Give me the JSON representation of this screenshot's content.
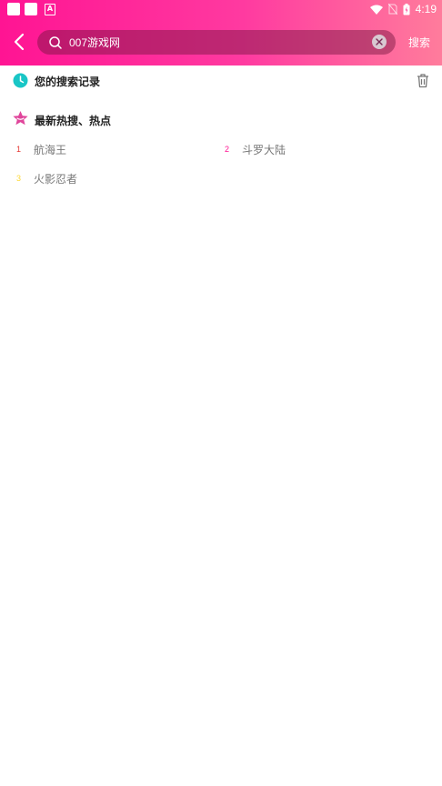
{
  "statusbar": {
    "time": "4:19"
  },
  "header": {
    "search_value": "007游戏网",
    "search_button": "搜索"
  },
  "history": {
    "title": "您的搜索记录"
  },
  "hot": {
    "title": "最新热搜、热点",
    "items": [
      {
        "rank": "1",
        "label": "航海王",
        "color": "#e53935"
      },
      {
        "rank": "2",
        "label": "斗罗大陆",
        "color": "#ff1493"
      },
      {
        "rank": "3",
        "label": "火影忍者",
        "color": "#fdd835"
      }
    ]
  },
  "colors": {
    "accent": "#ff1493",
    "history_icon": "#19c6c6",
    "star_icon": "#e0459b"
  }
}
